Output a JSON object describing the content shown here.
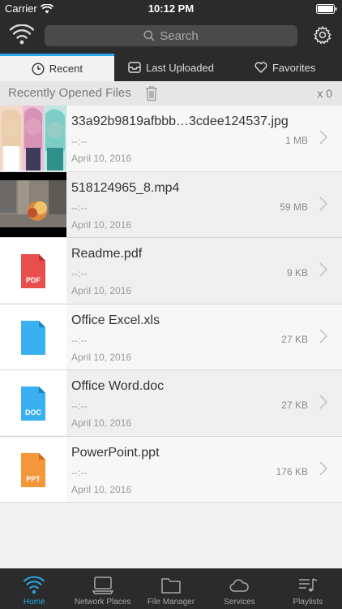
{
  "status": {
    "carrier": "Carrier",
    "time": "10:12 PM"
  },
  "search": {
    "placeholder": "Search"
  },
  "tabs": [
    {
      "label": "Recent",
      "icon": "clock-icon",
      "active": true
    },
    {
      "label": "Last Uploaded",
      "icon": "inbox-icon",
      "active": false
    },
    {
      "label": "Favorites",
      "icon": "heart-icon",
      "active": false
    }
  ],
  "section": {
    "title": "Recently Opened Files",
    "count": "x 0"
  },
  "files": [
    {
      "name": "33a92b9819afbbb…3cdee124537.jpg",
      "time": "--:--",
      "size": "1 MB",
      "date": "April 10, 2016",
      "kind": "image"
    },
    {
      "name": "518124965_8.mp4",
      "time": "--:--",
      "size": "59 MB",
      "date": "April 10, 2016",
      "kind": "video"
    },
    {
      "name": "Readme.pdf",
      "time": "--:--",
      "size": "9 KB",
      "date": "April 10, 2016",
      "kind": "pdf",
      "badge": "PDF"
    },
    {
      "name": "Office Excel.xls",
      "time": "--:--",
      "size": "27 KB",
      "date": "April 10, 2016",
      "kind": "xls",
      "badge": ""
    },
    {
      "name": "Office Word.doc",
      "time": "--:--",
      "size": "27 KB",
      "date": "April 10, 2016",
      "kind": "doc",
      "badge": "DOC"
    },
    {
      "name": "PowerPoint.ppt",
      "time": "--:--",
      "size": "176 KB",
      "date": "April 10, 2016",
      "kind": "ppt",
      "badge": "PPT"
    }
  ],
  "tabbar": [
    {
      "label": "Home",
      "icon": "wifi-icon",
      "active": true
    },
    {
      "label": "Network Places",
      "icon": "network-icon",
      "active": false
    },
    {
      "label": "File Manager",
      "icon": "folder-icon",
      "active": false
    },
    {
      "label": "Services",
      "icon": "cloud-icon",
      "active": false
    },
    {
      "label": "Playlists",
      "icon": "playlist-icon",
      "active": false
    }
  ],
  "colors": {
    "accent": "#2aa6e8",
    "bar": "#2b2b2b",
    "pdf": "#e94e4e",
    "xls": "#3ab0f0",
    "doc": "#3ab0f0",
    "ppt": "#f5963a"
  }
}
